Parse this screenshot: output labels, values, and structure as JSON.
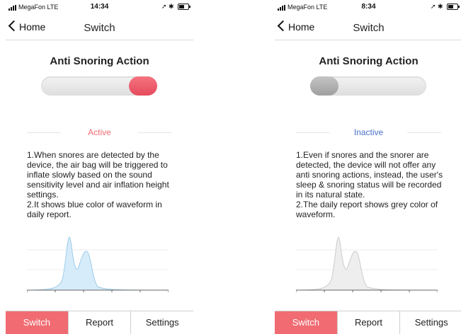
{
  "colors": {
    "accent": "#f06c72",
    "active_text": "#f06c72",
    "inactive_text": "#4a72c9",
    "wave_active_stroke": "#9ccbe8",
    "wave_active_fill": "#d7ecfa",
    "wave_inactive_stroke": "#cccccc",
    "wave_inactive_fill": "#eeeeee"
  },
  "screens": [
    {
      "status_bar": {
        "carrier": "MegaFon",
        "network": "LTE",
        "time": "14:34"
      },
      "nav": {
        "back_label": "Home",
        "title": "Switch"
      },
      "heading": "Anti Snoring Action",
      "toggle_state": "on",
      "status_label": "Active",
      "description": [
        "1.When snores are detected by the device, the air bag will be triggered to inflate slowly based on the sound sensitivity level and air inflation height settings.",
        "2.It shows blue color of waveform in daily report."
      ],
      "waveform_color": "blue",
      "tabs": [
        "Switch",
        "Report",
        "Settings"
      ],
      "active_tab": "Switch"
    },
    {
      "status_bar": {
        "carrier": "MegaFon",
        "network": "LTE",
        "time": "8:34"
      },
      "nav": {
        "back_label": "Home",
        "title": "Switch"
      },
      "heading": "Anti Snoring Action",
      "toggle_state": "off",
      "status_label": "Inactive",
      "description": [
        "1.Even if snores and the snorer are detected, the device will not offer any anti snoring actions, instead, the user's sleep & snoring status will be recorded in its natural state.",
        "2.The daily report shows grey color of waveform."
      ],
      "waveform_color": "grey",
      "tabs": [
        "Switch",
        "Report",
        "Settings"
      ],
      "active_tab": "Switch"
    }
  ]
}
